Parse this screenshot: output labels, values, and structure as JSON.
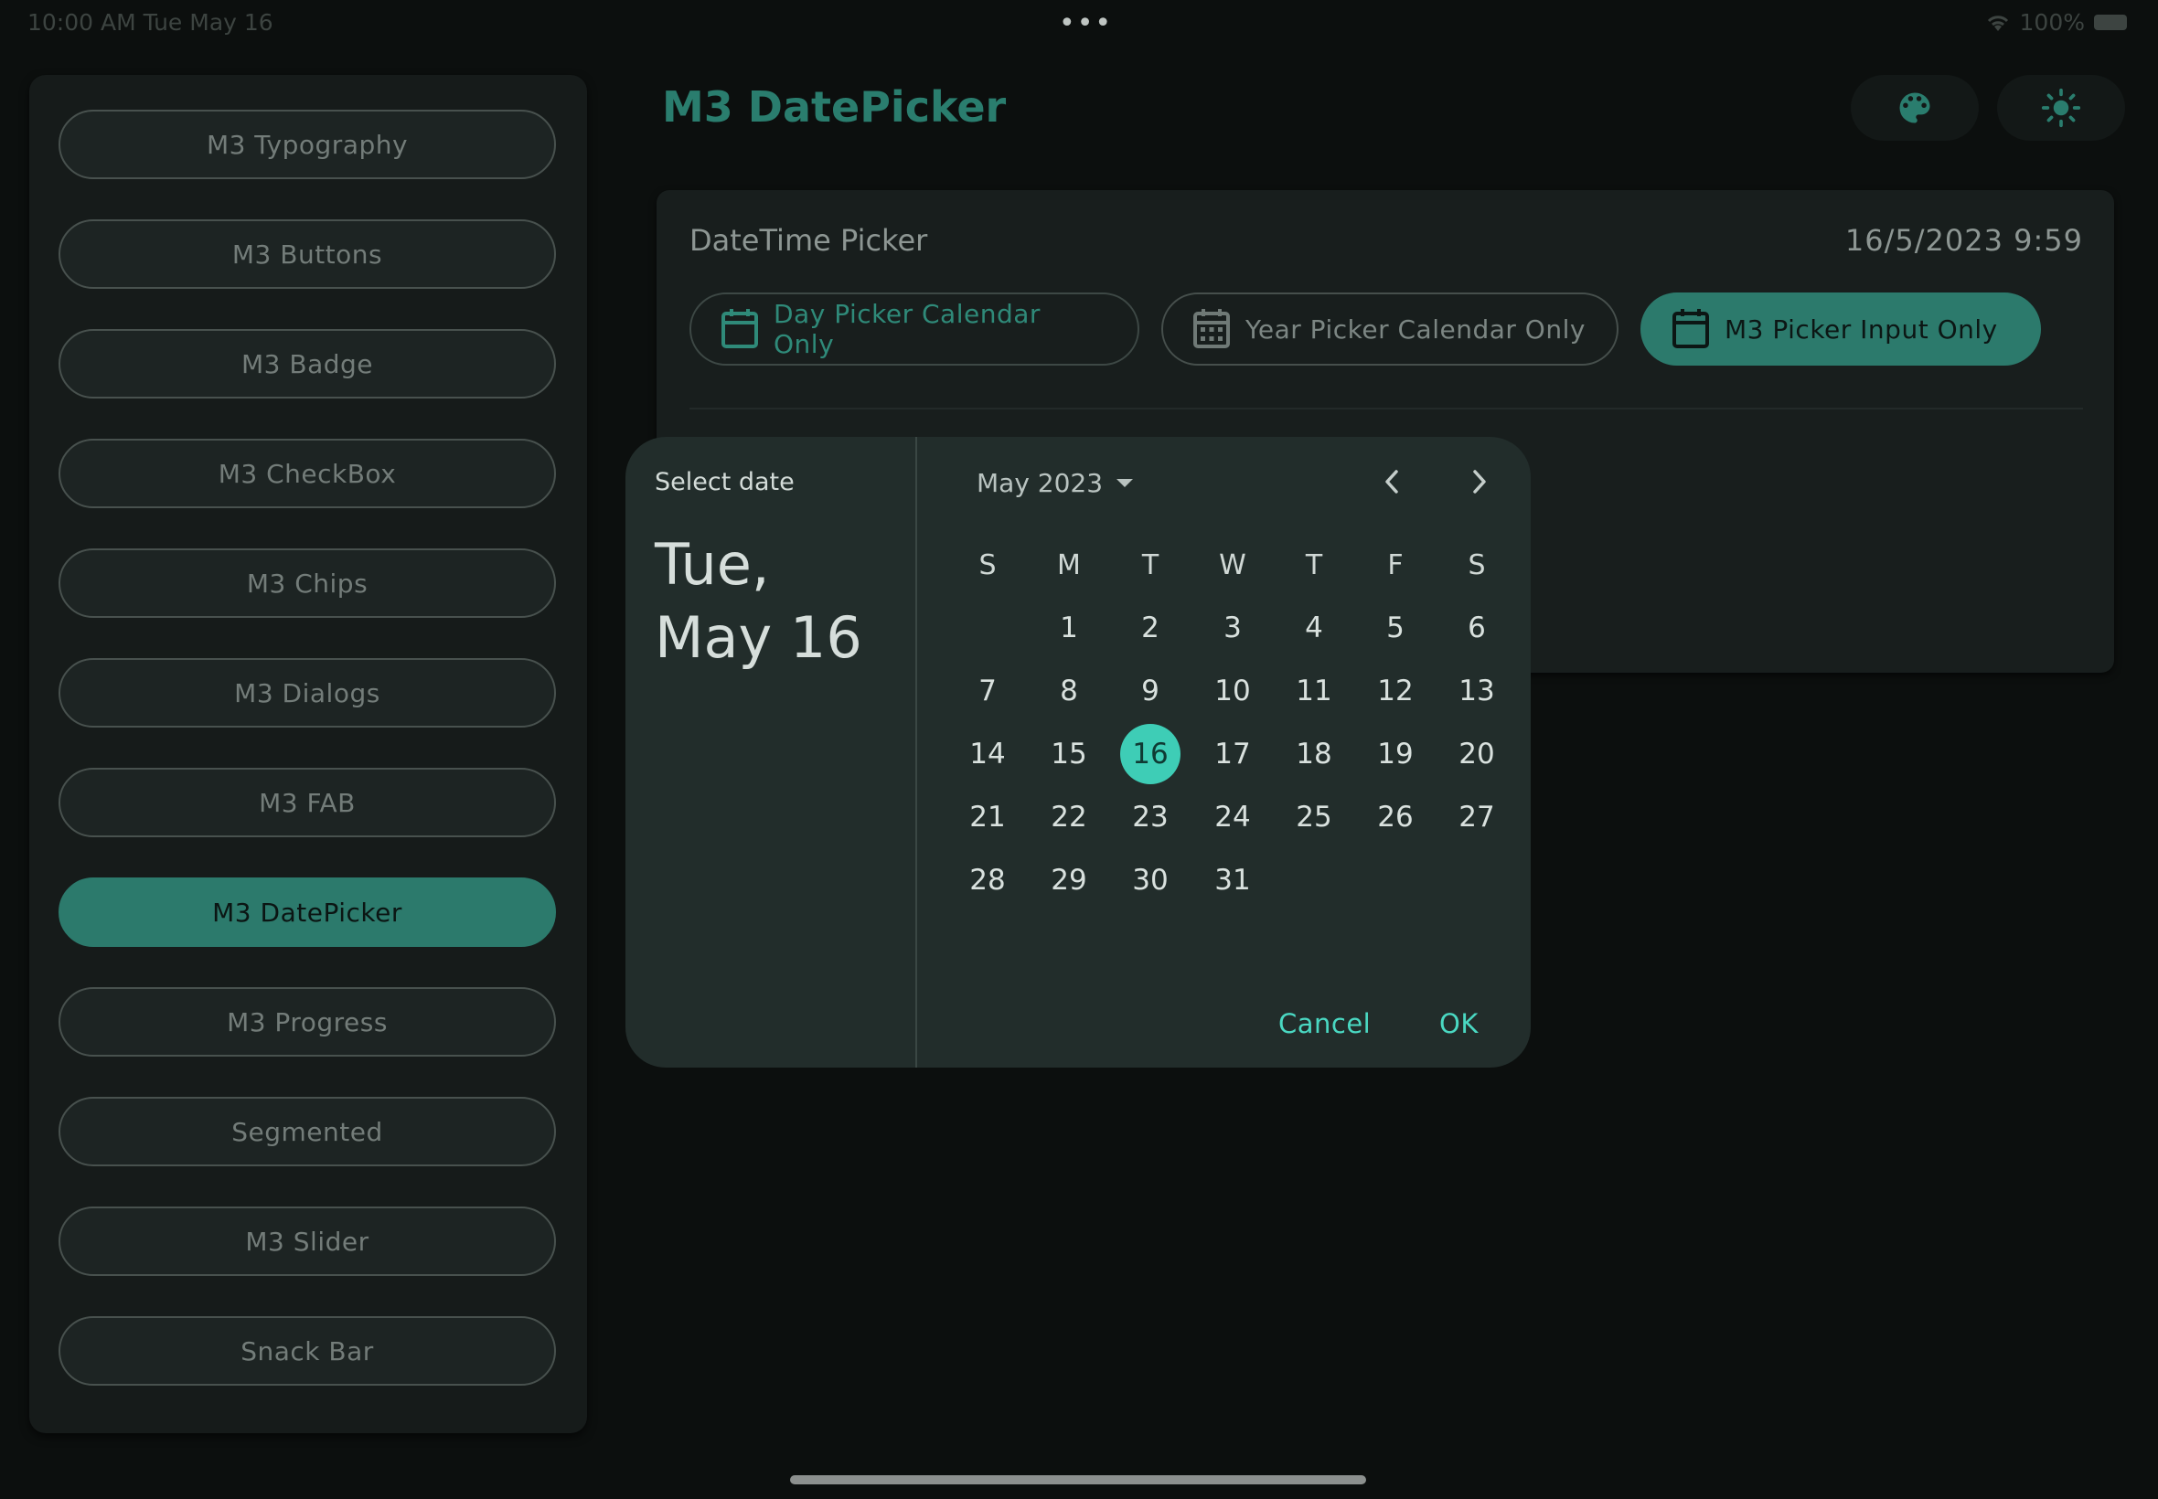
{
  "status_bar": {
    "time": "10:00 AM   Tue May 16",
    "dots": "•••",
    "battery": "100%"
  },
  "sidebar": {
    "items": [
      {
        "label": "M3 Typography",
        "active": false
      },
      {
        "label": "M3 Buttons",
        "active": false
      },
      {
        "label": "M3 Badge",
        "active": false
      },
      {
        "label": "M3 CheckBox",
        "active": false
      },
      {
        "label": "M3 Chips",
        "active": false
      },
      {
        "label": "M3 Dialogs",
        "active": false
      },
      {
        "label": "M3 FAB",
        "active": false
      },
      {
        "label": "M3 DatePicker",
        "active": true
      },
      {
        "label": "M3 Progress",
        "active": false
      },
      {
        "label": "Segmented",
        "active": false
      },
      {
        "label": "M3 Slider",
        "active": false
      },
      {
        "label": "Snack Bar",
        "active": false
      }
    ]
  },
  "header": {
    "title": "M3 DatePicker",
    "palette_icon": "palette-icon",
    "theme_icon": "sun-icon"
  },
  "card": {
    "title": "DateTime Picker",
    "datetime": "16/5/2023 9:59",
    "chips": [
      {
        "label": "Day Picker Calendar Only",
        "icon": "calendar-blank-icon",
        "style": "outlined-teal"
      },
      {
        "label": "Year Picker Calendar Only",
        "icon": "calendar-grid-icon",
        "style": "outlined-grey"
      },
      {
        "label": "M3 Picker Input Only",
        "icon": "calendar-blank-icon",
        "style": "filled"
      }
    ]
  },
  "dialog": {
    "select_label": "Select date",
    "headline_line1": "Tue,",
    "headline_line2": "May 16",
    "month_year": "May 2023",
    "weekdays": [
      "S",
      "M",
      "T",
      "W",
      "T",
      "F",
      "S"
    ],
    "first_weekday_index": 1,
    "days_in_month": 31,
    "selected_day": 16,
    "cancel_label": "Cancel",
    "ok_label": "OK"
  },
  "colors": {
    "accent": "#2c7a6c",
    "selected_day": "#3ecdb6",
    "action_text": "#4ad8c2",
    "background": "#0c0f0e"
  }
}
